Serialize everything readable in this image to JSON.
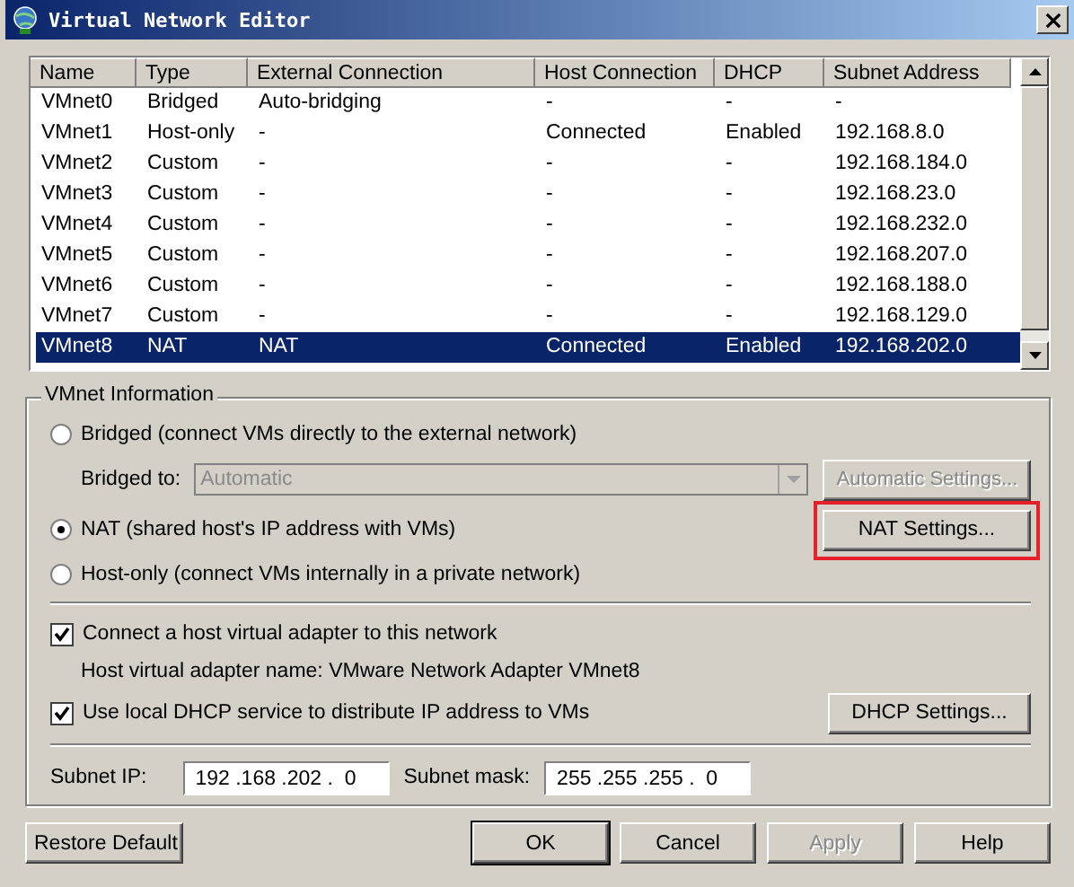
{
  "window": {
    "title": "Virtual Network Editor"
  },
  "table": {
    "columns": [
      "Name",
      "Type",
      "External Connection",
      "Host Connection",
      "DHCP",
      "Subnet Address"
    ],
    "rows": [
      {
        "cells": [
          "VMnet0",
          "Bridged",
          "Auto-bridging",
          "-",
          "-",
          "-"
        ],
        "selected": false
      },
      {
        "cells": [
          "VMnet1",
          "Host-only",
          "-",
          "Connected",
          "Enabled",
          "192.168.8.0"
        ],
        "selected": false
      },
      {
        "cells": [
          "VMnet2",
          "Custom",
          "-",
          "-",
          "-",
          "192.168.184.0"
        ],
        "selected": false
      },
      {
        "cells": [
          "VMnet3",
          "Custom",
          "-",
          "-",
          "-",
          "192.168.23.0"
        ],
        "selected": false
      },
      {
        "cells": [
          "VMnet4",
          "Custom",
          "-",
          "-",
          "-",
          "192.168.232.0"
        ],
        "selected": false
      },
      {
        "cells": [
          "VMnet5",
          "Custom",
          "-",
          "-",
          "-",
          "192.168.207.0"
        ],
        "selected": false
      },
      {
        "cells": [
          "VMnet6",
          "Custom",
          "-",
          "-",
          "-",
          "192.168.188.0"
        ],
        "selected": false
      },
      {
        "cells": [
          "VMnet7",
          "Custom",
          "-",
          "-",
          "-",
          "192.168.129.0"
        ],
        "selected": false
      },
      {
        "cells": [
          "VMnet8",
          "NAT",
          "NAT",
          "Connected",
          "Enabled",
          "192.168.202.0"
        ],
        "selected": true
      }
    ]
  },
  "vmnet_information": {
    "title": "VMnet Information",
    "options": [
      {
        "label": "Bridged (connect VMs directly to the external network)",
        "selected": false
      },
      {
        "label": "NAT (shared host's IP address with VMs)",
        "selected": true
      },
      {
        "label": "Host-only (connect VMs internally in a private network)",
        "selected": false
      }
    ],
    "bridged_to": {
      "label": "Bridged to:",
      "value": "Automatic",
      "disabled": true
    },
    "automatic_settings": {
      "label": "Automatic Settings...",
      "disabled": true
    },
    "nat_settings": {
      "label": "NAT Settings...",
      "highlighted": true
    },
    "connect_adapter": {
      "label": "Connect a host virtual adapter to this network",
      "checked": true
    },
    "adapter_name": "Host virtual adapter name: VMware Network Adapter VMnet8",
    "use_dhcp": {
      "label": "Use local DHCP service to distribute IP address to VMs",
      "checked": true
    },
    "dhcp_settings": {
      "label": "DHCP Settings..."
    },
    "subnet_ip": {
      "label": "Subnet IP:",
      "value": "192 .168 .202 .  0"
    },
    "subnet_mask": {
      "label": "Subnet mask:",
      "value": "255 .255 .255 .  0"
    }
  },
  "restore_button": {
    "label": "Restore Default"
  },
  "buttons": [
    {
      "label": "OK",
      "disabled": false,
      "default": true
    },
    {
      "label": "Cancel",
      "disabled": false,
      "default": false
    },
    {
      "label": "Apply",
      "disabled": true,
      "default": false
    },
    {
      "label": "Help",
      "disabled": false,
      "default": false
    }
  ]
}
